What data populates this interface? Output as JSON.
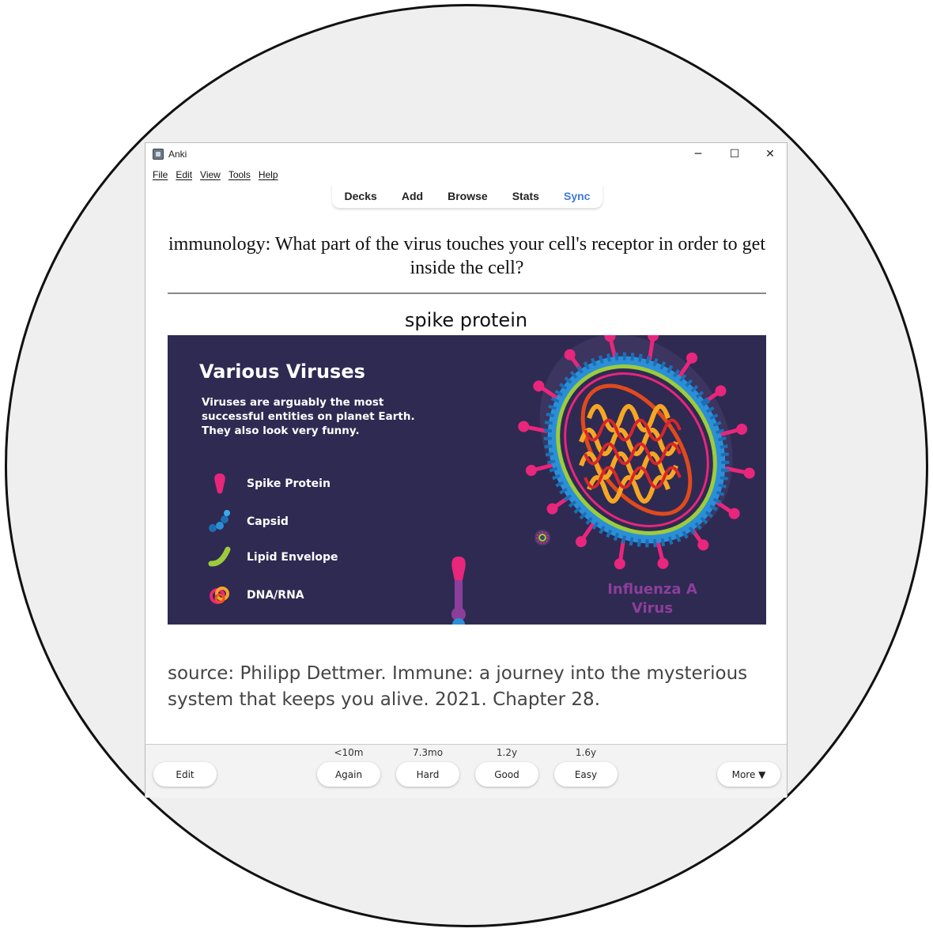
{
  "window": {
    "title": "Anki"
  },
  "menu": {
    "items": [
      "File",
      "Edit",
      "View",
      "Tools",
      "Help"
    ]
  },
  "toolbar": {
    "decks": "Decks",
    "add": "Add",
    "browse": "Browse",
    "stats": "Stats",
    "sync": "Sync",
    "sync_color": "#3e7bd6"
  },
  "card": {
    "question": "immunology: What part of the virus touches your cell's receptor in order to get inside the cell?",
    "answer": "spike protein",
    "image": {
      "title": "Various Viruses",
      "subtitle": "Viruses are arguably the most successful entities on planet Earth. They also look very funny.",
      "legend": [
        {
          "label": "Spike Protein",
          "icon": "spike-protein-icon",
          "color": "#e8267c"
        },
        {
          "label": "Capsid",
          "icon": "capsid-icon",
          "color": "#2b8fd8"
        },
        {
          "label": "Lipid Envelope",
          "icon": "lipid-envelope-icon",
          "color": "#9ccc3c"
        },
        {
          "label": "DNA/RNA",
          "icon": "dna-rna-icon",
          "color": "#f5a623"
        }
      ],
      "virus_label": "Influenza A Virus",
      "background": "#2f2a52"
    },
    "source": "source: Philipp Dettmer. Immune: a journey into the mysterious system that keeps you alive. 2021. Chapter 28."
  },
  "review": {
    "edit": "Edit",
    "more": "More ▼",
    "answers": [
      {
        "label": "Again",
        "interval": "<10m"
      },
      {
        "label": "Hard",
        "interval": "7.3mo"
      },
      {
        "label": "Good",
        "interval": "1.2y"
      },
      {
        "label": "Easy",
        "interval": "1.6y"
      }
    ]
  }
}
